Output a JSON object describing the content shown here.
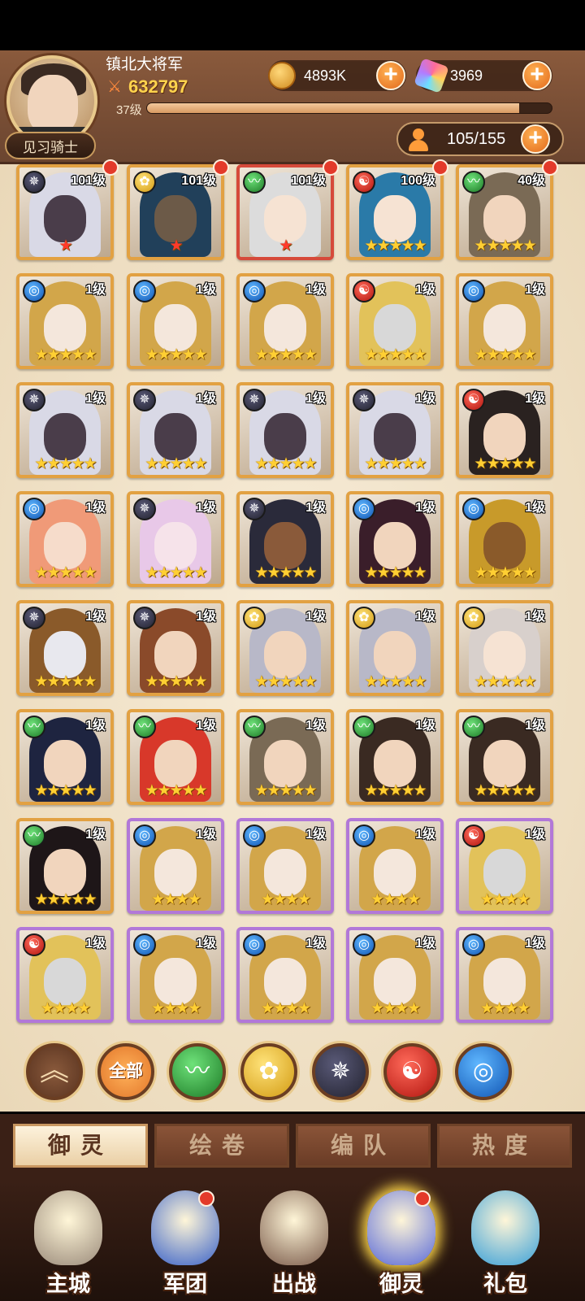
{
  "player": {
    "name": "镇北大将军",
    "power": "632797",
    "level_label": "37级",
    "xp_progress": 0.92,
    "rank": "见习骑士"
  },
  "resources": {
    "gold": "4893K",
    "gems": "3969",
    "roster": "105/155"
  },
  "heroes": [
    {
      "level": "101级",
      "element": "dark",
      "rarity": "orange",
      "stars": "★",
      "star_color": "red",
      "hair": "#d9d9e6",
      "skin": "#4a3d4a",
      "dot": true
    },
    {
      "level": "101级",
      "element": "light",
      "rarity": "orange",
      "stars": "★",
      "star_color": "red",
      "hair": "#21405a",
      "skin": "#6c5a48",
      "dot": true
    },
    {
      "level": "101级",
      "element": "wind",
      "rarity": "red",
      "stars": "★",
      "star_color": "red",
      "hair": "#dcdcdc",
      "skin": "#f6e3d3",
      "dot": true
    },
    {
      "level": "100级",
      "element": "fire",
      "rarity": "orange",
      "stars": "★★★★★",
      "star_color": "gold",
      "hair": "#2a7aa8",
      "skin": "#f6e3d3",
      "dot": true
    },
    {
      "level": "40级",
      "element": "wind",
      "rarity": "orange",
      "stars": "★★★★★",
      "star_color": "gold",
      "hair": "#7a6a55",
      "skin": "#f1d5bd",
      "dot": true
    },
    {
      "level": "1级",
      "element": "water",
      "rarity": "orange",
      "stars": "★★★★★",
      "star_color": "gold",
      "hair": "#d2a64a",
      "skin": "#f4e7dc"
    },
    {
      "level": "1级",
      "element": "water",
      "rarity": "orange",
      "stars": "★★★★★",
      "star_color": "gold",
      "hair": "#d2a64a",
      "skin": "#f4e7dc"
    },
    {
      "level": "1级",
      "element": "water",
      "rarity": "orange",
      "stars": "★★★★★",
      "star_color": "gold",
      "hair": "#d2a64a",
      "skin": "#f4e7dc"
    },
    {
      "level": "1级",
      "element": "fire",
      "rarity": "orange",
      "stars": "★★★★★",
      "star_color": "gold",
      "hair": "#e2c25a",
      "skin": "#d8d8d8"
    },
    {
      "level": "1级",
      "element": "water",
      "rarity": "orange",
      "stars": "★★★★★",
      "star_color": "gold",
      "hair": "#d2a64a",
      "skin": "#f4e7dc"
    },
    {
      "level": "1级",
      "element": "dark",
      "rarity": "orange",
      "stars": "★★★★★",
      "star_color": "gold",
      "hair": "#d9d9e6",
      "skin": "#4a3d4a"
    },
    {
      "level": "1级",
      "element": "dark",
      "rarity": "orange",
      "stars": "★★★★★",
      "star_color": "gold",
      "hair": "#d9d9e6",
      "skin": "#4a3d4a"
    },
    {
      "level": "1级",
      "element": "dark",
      "rarity": "orange",
      "stars": "★★★★★",
      "star_color": "gold",
      "hair": "#d9d9e6",
      "skin": "#4a3d4a"
    },
    {
      "level": "1级",
      "element": "dark",
      "rarity": "orange",
      "stars": "★★★★★",
      "star_color": "gold",
      "hair": "#d9d9e6",
      "skin": "#4a3d4a"
    },
    {
      "level": "1级",
      "element": "fire",
      "rarity": "orange",
      "stars": "★★★★★",
      "star_color": "gold",
      "hair": "#2a2220",
      "skin": "#f1d5bd"
    },
    {
      "level": "1级",
      "element": "water",
      "rarity": "orange",
      "stars": "★★★★★",
      "star_color": "gold",
      "hair": "#f09a78",
      "skin": "#f6dccb"
    },
    {
      "level": "1级",
      "element": "dark",
      "rarity": "orange",
      "stars": "★★★★★",
      "star_color": "gold",
      "hair": "#e8c8e8",
      "skin": "#f6e3ea"
    },
    {
      "level": "1级",
      "element": "dark",
      "rarity": "orange",
      "stars": "★★★★★",
      "star_color": "gold",
      "hair": "#2a2a3a",
      "skin": "#8a5a3a"
    },
    {
      "level": "1级",
      "element": "water",
      "rarity": "orange",
      "stars": "★★★★★",
      "star_color": "gold",
      "hair": "#3a1e2a",
      "skin": "#f1d5bd"
    },
    {
      "level": "1级",
      "element": "water",
      "rarity": "orange",
      "stars": "★★★★★",
      "star_color": "gold",
      "hair": "#c89a2a",
      "skin": "#8a5a2a"
    },
    {
      "level": "1级",
      "element": "dark",
      "rarity": "orange",
      "stars": "★★★★★",
      "star_color": "gold",
      "hair": "#8a5a2a",
      "skin": "#e8e8ee"
    },
    {
      "level": "1级",
      "element": "dark",
      "rarity": "orange",
      "stars": "★★★★★",
      "star_color": "gold",
      "hair": "#8a4a2a",
      "skin": "#f1d5bd"
    },
    {
      "level": "1级",
      "element": "light",
      "rarity": "orange",
      "stars": "★★★★★",
      "star_color": "gold",
      "hair": "#b8b8c8",
      "skin": "#f1d5bd"
    },
    {
      "level": "1级",
      "element": "light",
      "rarity": "orange",
      "stars": "★★★★★",
      "star_color": "gold",
      "hair": "#b8b8c8",
      "skin": "#f1d5bd"
    },
    {
      "level": "1级",
      "element": "light",
      "rarity": "orange",
      "stars": "★★★★★",
      "star_color": "gold",
      "hair": "#d8d0cc",
      "skin": "#f6e3d3"
    },
    {
      "level": "1级",
      "element": "wind",
      "rarity": "orange",
      "stars": "★★★★★",
      "star_color": "gold",
      "hair": "#1e2440",
      "skin": "#f1d5bd"
    },
    {
      "level": "1级",
      "element": "wind",
      "rarity": "orange",
      "stars": "★★★★★",
      "star_color": "gold",
      "hair": "#d8382a",
      "skin": "#f1d5bd"
    },
    {
      "level": "1级",
      "element": "wind",
      "rarity": "orange",
      "stars": "★★★★★",
      "star_color": "gold",
      "hair": "#7a6a55",
      "skin": "#f1d5bd"
    },
    {
      "level": "1级",
      "element": "wind",
      "rarity": "orange",
      "stars": "★★★★★",
      "star_color": "gold",
      "hair": "#3a2a22",
      "skin": "#f1d5bd"
    },
    {
      "level": "1级",
      "element": "wind",
      "rarity": "orange",
      "stars": "★★★★★",
      "star_color": "gold",
      "hair": "#3a2a22",
      "skin": "#f1d5bd"
    },
    {
      "level": "1级",
      "element": "wind",
      "rarity": "orange",
      "stars": "★★★★★",
      "star_color": "gold",
      "hair": "#1e1618",
      "skin": "#f1d5bd"
    },
    {
      "level": "1级",
      "element": "water",
      "rarity": "purple",
      "stars": "★★★★",
      "star_color": "gold",
      "hair": "#d2a64a",
      "skin": "#f4e7dc"
    },
    {
      "level": "1级",
      "element": "water",
      "rarity": "purple",
      "stars": "★★★★",
      "star_color": "gold",
      "hair": "#d2a64a",
      "skin": "#f4e7dc"
    },
    {
      "level": "1级",
      "element": "water",
      "rarity": "purple",
      "stars": "★★★★",
      "star_color": "gold",
      "hair": "#d2a64a",
      "skin": "#f4e7dc"
    },
    {
      "level": "1级",
      "element": "fire",
      "rarity": "purple",
      "stars": "★★★★",
      "star_color": "gold",
      "hair": "#e2c25a",
      "skin": "#d8d8d8"
    },
    {
      "level": "1级",
      "element": "fire",
      "rarity": "purple",
      "stars": "★★★★",
      "star_color": "gold",
      "hair": "#e2c25a",
      "skin": "#d8d8d8"
    },
    {
      "level": "1级",
      "element": "water",
      "rarity": "purple",
      "stars": "★★★★",
      "star_color": "gold",
      "hair": "#d2a64a",
      "skin": "#f4e7dc"
    },
    {
      "level": "1级",
      "element": "water",
      "rarity": "purple",
      "stars": "★★★★",
      "star_color": "gold",
      "hair": "#d2a64a",
      "skin": "#f4e7dc"
    },
    {
      "level": "1级",
      "element": "water",
      "rarity": "purple",
      "stars": "★★★★",
      "star_color": "gold",
      "hair": "#d2a64a",
      "skin": "#f4e7dc"
    },
    {
      "level": "1级",
      "element": "water",
      "rarity": "purple",
      "stars": "★★★★",
      "star_color": "gold",
      "hair": "#d2a64a",
      "skin": "#f4e7dc"
    }
  ],
  "filters": {
    "collapse_icon": "double-chevron-up-icon",
    "all_label": "全部",
    "elements": [
      "wind",
      "light",
      "dark",
      "fire",
      "water"
    ]
  },
  "tabs": [
    "御灵",
    "绘卷",
    "编队",
    "热度"
  ],
  "active_tab": 0,
  "nav": [
    {
      "label": "主城",
      "icon": "castle-icon",
      "color": "#9a8a7a"
    },
    {
      "label": "军团",
      "icon": "fist-shield-icon",
      "color": "#3a62c8",
      "dot": true
    },
    {
      "label": "出战",
      "icon": "battle-gate-icon",
      "color": "#7a5a4a"
    },
    {
      "label": "御灵",
      "icon": "crystal-icon",
      "color": "#5a6ad8",
      "dot": true,
      "active": true
    },
    {
      "label": "礼包",
      "icon": "shop-stall-icon",
      "color": "#3aa0d8"
    }
  ],
  "element_glyphs": {
    "water": "◎",
    "dark": "✵",
    "fire": "☯",
    "wind": "〰",
    "light": "✿"
  }
}
